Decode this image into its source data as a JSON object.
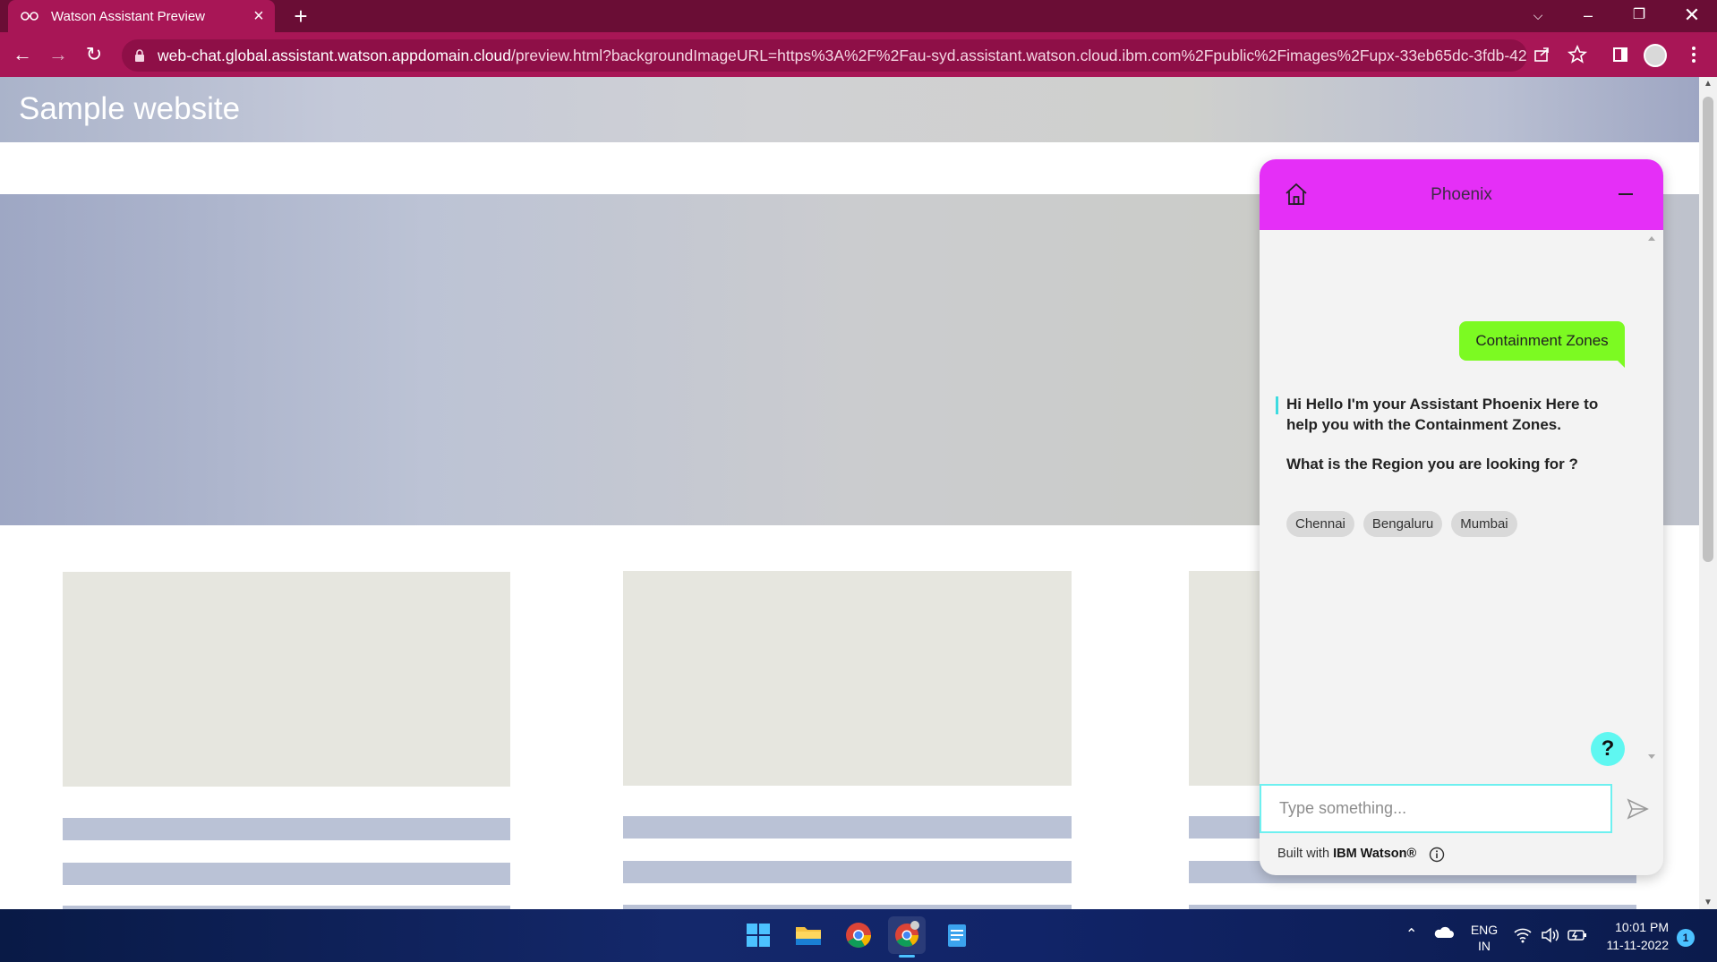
{
  "browser": {
    "tab_title": "Watson Assistant Preview",
    "url_host": "web-chat.global.assistant.watson.appdomain.cloud",
    "url_path": "/preview.html?backgroundImageURL=https%3A%2F%2Fau-syd.assistant.watson.cloud.ibm.com%2Fpublic%2Fimages%2Fupx-33eb65dc-3fdb-42..."
  },
  "site": {
    "title": "Sample website"
  },
  "chat": {
    "title": "Phoenix",
    "user_message": "Containment Zones",
    "bot_message": "Hi Hello I'm your Assistant Phoenix Here to help you with the Containment Zones.",
    "bot_question": "What is the Region you are looking for ?",
    "options": [
      "Chennai",
      "Bengaluru",
      "Mumbai"
    ],
    "help_label": "?",
    "input_placeholder": "Type something...",
    "footer_prefix": "Built with",
    "footer_brand": "IBM Watson®"
  },
  "taskbar": {
    "lang_top": "ENG",
    "lang_bottom": "IN",
    "time": "10:01 PM",
    "date": "11-11-2022",
    "notification_count": "1"
  },
  "colors": {
    "browser_frame": "#6a0d35",
    "browser_toolbar": "#a81656",
    "chat_header": "#e52ff7",
    "user_bubble": "#7cfa22",
    "accent_cyan": "#5ff7f1"
  }
}
